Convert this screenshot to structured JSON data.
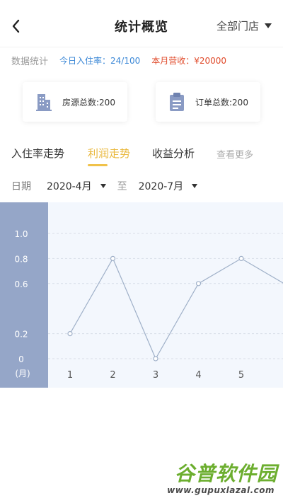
{
  "header": {
    "title": "统计概览",
    "store_select": "全部门店"
  },
  "stats": {
    "label": "数据统计",
    "occupancy": "今日入住率：24/100",
    "revenue": "本月营收：¥20000"
  },
  "cards": [
    {
      "icon": "building-icon",
      "text": "房源总数:200"
    },
    {
      "icon": "clipboard-icon",
      "text": "订单总数:200"
    }
  ],
  "tabs": [
    {
      "label": "入住率走势",
      "active": false
    },
    {
      "label": "利润走势",
      "active": true
    },
    {
      "label": "收益分析",
      "active": false
    },
    {
      "label": "查看更多",
      "active": false
    }
  ],
  "date_filter": {
    "label": "日期",
    "start": "2020-4月",
    "to": "至",
    "end": "2020-7月"
  },
  "chart_data": {
    "type": "line",
    "x": [
      1,
      2,
      3,
      4,
      5,
      6
    ],
    "xticks": [
      "1",
      "2",
      "3",
      "4",
      "5"
    ],
    "series": [
      {
        "values": [
          0.2,
          0.8,
          0,
          0.6,
          0.8,
          0.6
        ]
      }
    ],
    "ylim": [
      0,
      1.0
    ],
    "yticks": [
      "1.0",
      "0.8",
      "0.6",
      "0.2",
      "0"
    ],
    "ytick_values": [
      1.0,
      0.8,
      0.6,
      0.2,
      0
    ],
    "ylabel": "(月)",
    "grid": true,
    "colors": {
      "line": "#9fb0c8",
      "grid": "#d8dee8",
      "ytext": "#ffffff",
      "xtext": "#555555"
    }
  },
  "watermark": {
    "title": "谷普软件园",
    "url": "www.gupuxlazal.com"
  },
  "colors": {
    "accent": "#f0c24a",
    "occupancy": "#3a87d6",
    "revenue": "#e04a2a",
    "icon": "#8a9bc4"
  }
}
